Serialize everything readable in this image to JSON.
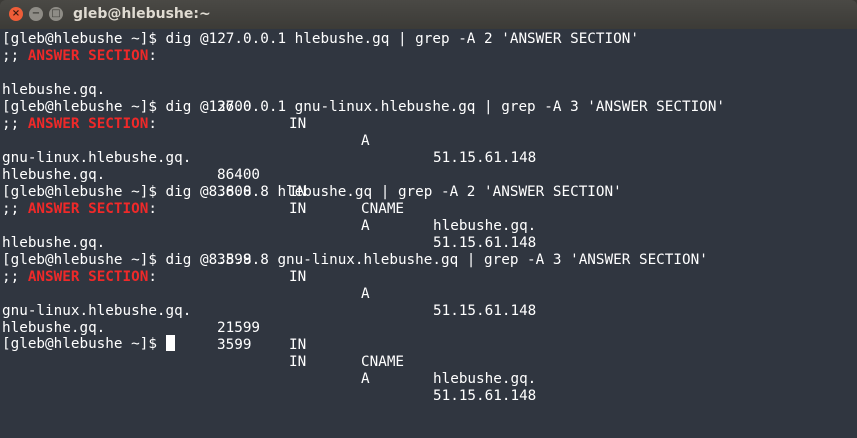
{
  "window": {
    "title": "gleb@hlebushe:~",
    "close": "×",
    "minimize": "−",
    "maximize": "□"
  },
  "prompt": "[gleb@hlebushe ~]$",
  "commands": [
    "dig @127.0.0.1 hlebushe.gq | grep -A 2 'ANSWER SECTION'",
    "dig @127.0.0.1 gnu-linux.hlebushe.gq | grep -A 3 'ANSWER SECTION'",
    "dig @8.8.8.8 hlebushe.gq | grep -A 2 'ANSWER SECTION'",
    "dig @8.8.8.8 gnu-linux.hlebushe.gq | grep -A 3 'ANSWER SECTION'"
  ],
  "section": {
    "prefix": ";; ",
    "label": "ANSWER SECTION",
    "suffix": ":"
  },
  "records": {
    "r1a": [
      "hlebushe.gq.",
      "3600",
      "IN",
      "A",
      "51.15.61.148"
    ],
    "r2a": [
      "gnu-linux.hlebushe.gq.",
      "86400",
      "IN",
      "CNAME",
      "hlebushe.gq."
    ],
    "r2b": [
      "hlebushe.gq.",
      "3600",
      "IN",
      "A",
      "51.15.61.148"
    ],
    "r3a": [
      "hlebushe.gq.",
      "3599",
      "IN",
      "A",
      "51.15.61.148"
    ],
    "r4a": [
      "gnu-linux.hlebushe.gq.",
      "21599",
      "IN",
      "CNAME",
      "hlebushe.gq."
    ],
    "r4b": [
      "hlebushe.gq.",
      "3599",
      "IN",
      "A",
      "51.15.61.148"
    ]
  }
}
